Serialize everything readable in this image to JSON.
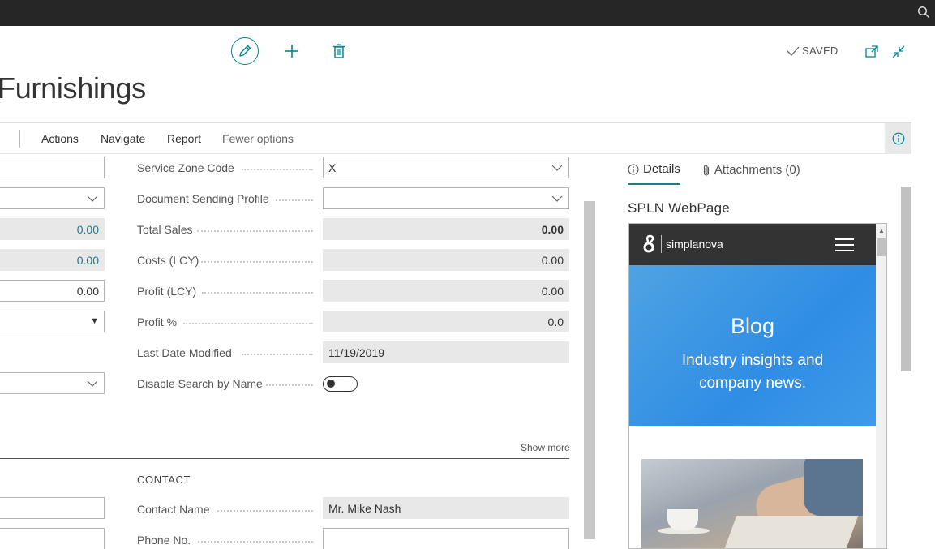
{
  "header": {
    "saved_label": "SAVED",
    "page_title": "Furnishings"
  },
  "actions": {
    "items": [
      "Actions",
      "Navigate",
      "Report",
      "Fewer options"
    ]
  },
  "left_fields": {
    "row1": "",
    "row2": "",
    "row3": "0.00",
    "row4": "0.00",
    "row5": "0.00",
    "row6": "",
    "row8": ""
  },
  "fields": {
    "service_zone_code": {
      "label": "Service Zone Code",
      "value": "X"
    },
    "document_sending_profile": {
      "label": "Document Sending Profile",
      "value": ""
    },
    "total_sales": {
      "label": "Total Sales",
      "value": "0.00"
    },
    "costs_lcy": {
      "label": "Costs (LCY)",
      "value": "0.00"
    },
    "profit_lcy": {
      "label": "Profit (LCY)",
      "value": "0.00"
    },
    "profit_pct": {
      "label": "Profit %",
      "value": "0.0"
    },
    "last_date_modified": {
      "label": "Last Date Modified",
      "value": "11/19/2019"
    },
    "disable_search_by_name": {
      "label": "Disable Search by Name",
      "value": false
    }
  },
  "show_more": "Show more",
  "contact": {
    "title": "CONTACT",
    "contact_name": {
      "label": "Contact Name",
      "value": "Mr. Mike Nash"
    },
    "phone_no": {
      "label": "Phone No.",
      "value": ""
    }
  },
  "factbox": {
    "tabs": [
      {
        "label": "Details",
        "active": true
      },
      {
        "label": "Attachments (0)",
        "active": false
      }
    ],
    "heading": "SPLN WebPage",
    "web": {
      "logo_text": "simplanova",
      "hero_title": "Blog",
      "hero_subtitle": "Industry insights and company news."
    }
  },
  "colors": {
    "accent": "#00838f",
    "topbar": "#262626",
    "link_value": "#1f7a8c",
    "hero_blue": "#2f8de4"
  },
  "icons": [
    "search-icon",
    "edit-icon",
    "plus-icon",
    "delete-icon",
    "checkmark-icon",
    "popout-icon",
    "collapse-icon",
    "info-icon",
    "paperclip-icon",
    "menu-icon",
    "chevron-down-icon"
  ]
}
